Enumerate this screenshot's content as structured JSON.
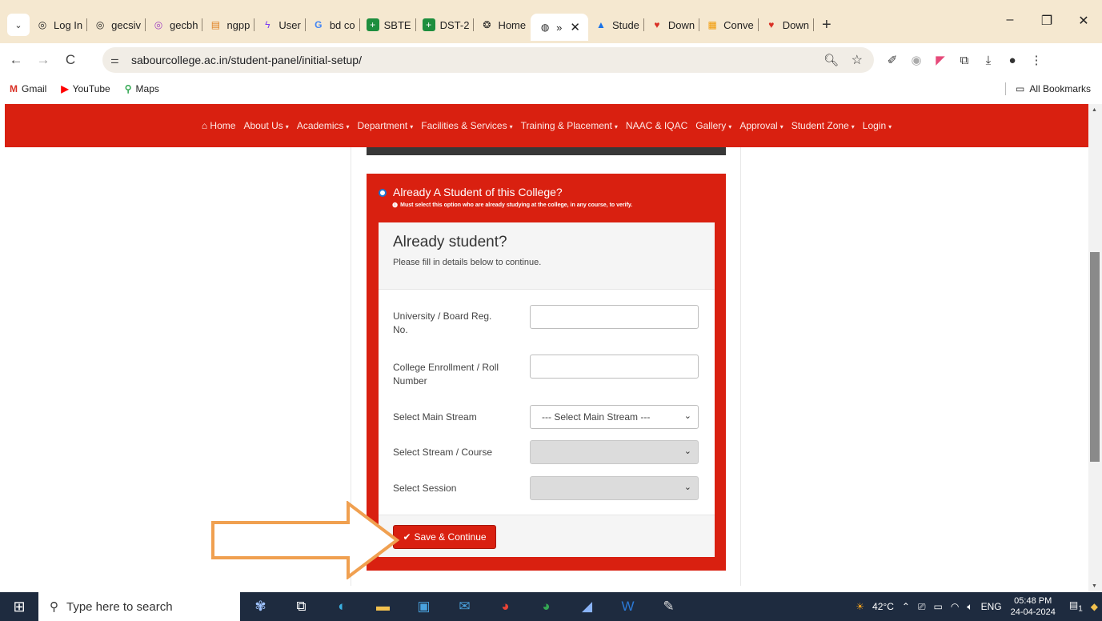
{
  "browser": {
    "tabs": [
      {
        "label": "Log In",
        "icon": "chrome-icon"
      },
      {
        "label": "gecsiv",
        "icon": "chrome-icon"
      },
      {
        "label": "gecbh",
        "icon": "chrome-icon"
      },
      {
        "label": "ngpp",
        "icon": "document-icon"
      },
      {
        "label": "User",
        "icon": "bolt-icon"
      },
      {
        "label": "bd co",
        "icon": "google-icon"
      },
      {
        "label": "SBTE",
        "icon": "plus-square-icon"
      },
      {
        "label": "DST-2",
        "icon": "plus-square-icon"
      },
      {
        "label": "Home",
        "icon": "college-icon"
      },
      {
        "label": "»",
        "icon": "globe-icon",
        "active": true
      },
      {
        "label": "Stude",
        "icon": "drive-icon"
      },
      {
        "label": "Down",
        "icon": "heart-icon"
      },
      {
        "label": "Conve",
        "icon": "grid-icon"
      },
      {
        "label": "Down",
        "icon": "heart-icon"
      }
    ],
    "new_tab": "+",
    "window_controls": {
      "minimize": "–",
      "restore": "❐",
      "close": "✕"
    },
    "url": "sabourcollege.ac.in/student-panel/initial-setup/",
    "bookmarks": [
      {
        "label": "Gmail",
        "icon": "gmail-icon"
      },
      {
        "label": "YouTube",
        "icon": "youtube-icon"
      },
      {
        "label": "Maps",
        "icon": "maps-icon"
      }
    ],
    "all_bookmarks": "All Bookmarks"
  },
  "site_nav": {
    "items": [
      "Home",
      "About Us",
      "Academics",
      "Department",
      "Facilities & Services",
      "Training & Placement",
      "NAAC & IQAC",
      "Gallery",
      "Approval",
      "Student Zone",
      "Login"
    ],
    "brand_color": "#d92010"
  },
  "form": {
    "option_title": "Already A Student of this College?",
    "option_hint": "Must select this option who are already studying at the college, in any course, to verify.",
    "card_title": "Already student?",
    "card_subtitle": "Please fill in details below to continue.",
    "fields": {
      "reg_no_label": "University / Board Reg. No.",
      "roll_label": "College Enrollment / Roll Number",
      "stream_label": "Select Main Stream",
      "stream_value": "--- Select Main Stream ---",
      "course_label": "Select Stream / Course",
      "session_label": "Select Session"
    },
    "save_button": "Save & Continue"
  },
  "taskbar": {
    "search_placeholder": "Type here to search",
    "weather": "42°C",
    "language": "ENG",
    "time": "05:48 PM",
    "date": "24-04-2024",
    "notification_count": "1"
  }
}
